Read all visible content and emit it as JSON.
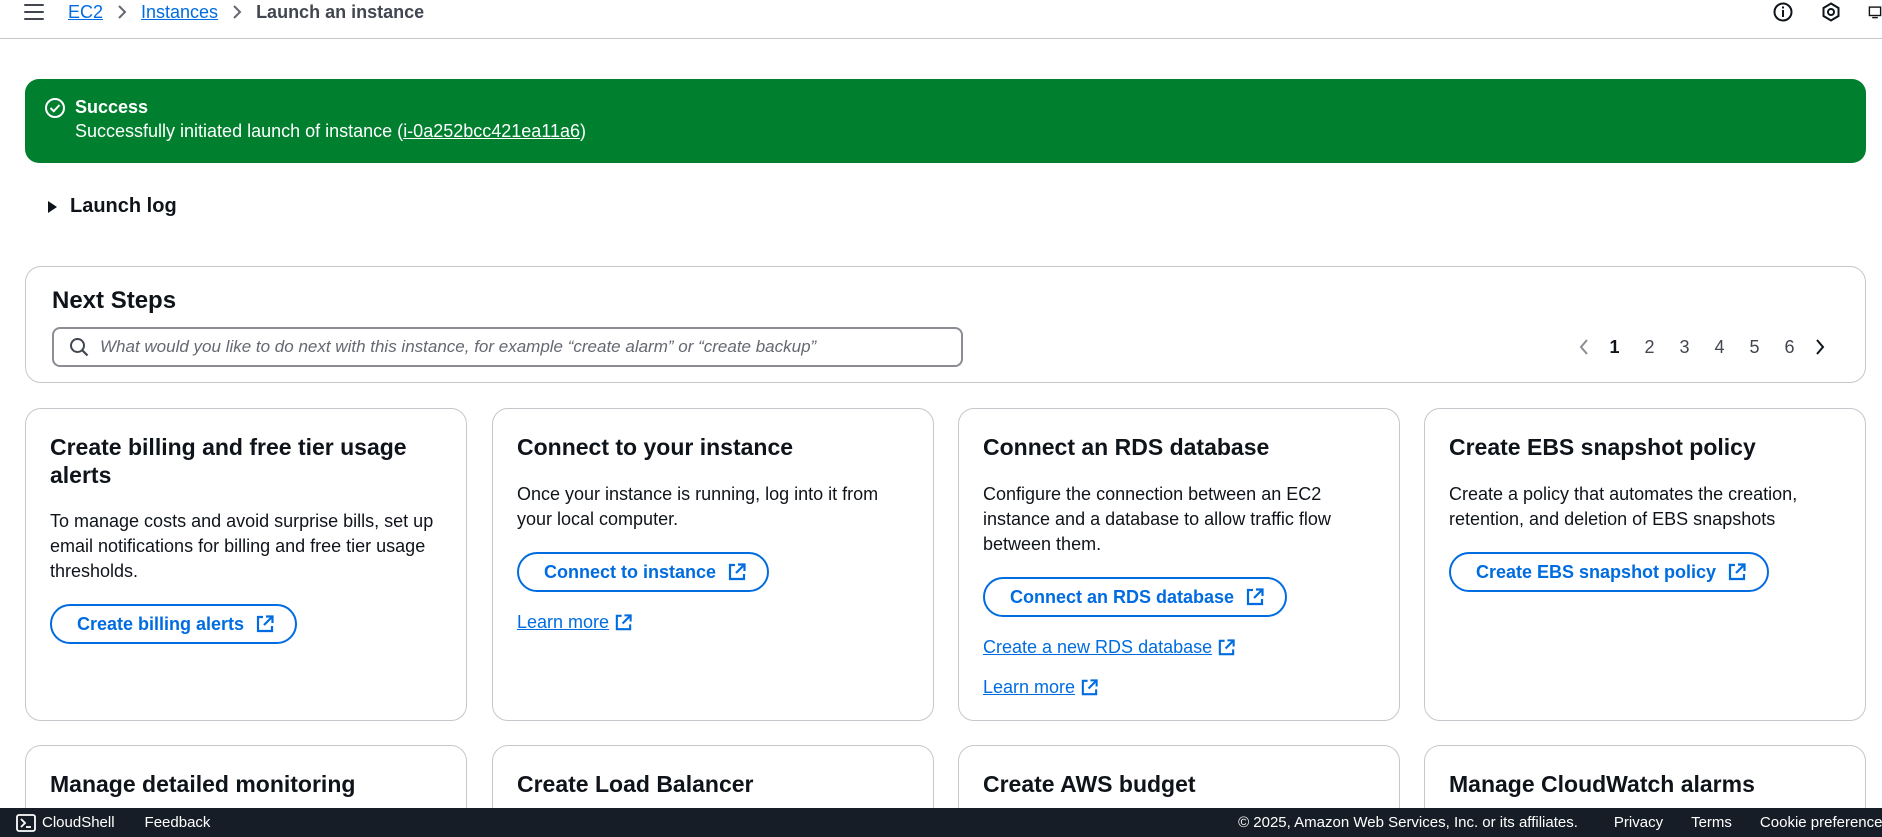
{
  "breadcrumb": {
    "items": [
      "EC2",
      "Instances"
    ],
    "current": "Launch an instance"
  },
  "flash": {
    "title": "Success",
    "message_prefix": "Successfully initiated launch of instance (",
    "instance_id": "i-0a252bcc421ea11a6",
    "message_suffix": ")",
    "color": "#00802f"
  },
  "launch_log": {
    "label": "Launch log"
  },
  "next_steps": {
    "title": "Next Steps",
    "search_placeholder": "What would you like to do next with this instance, for example “create alarm” or “create backup”",
    "pages": [
      "1",
      "2",
      "3",
      "4",
      "5",
      "6"
    ],
    "current_page": "1"
  },
  "cards": [
    {
      "title": "Create billing and free tier usage alerts",
      "description": "To manage costs and avoid surprise bills, set up email notifications for billing and free tier usage thresholds.",
      "button": "Create billing alerts"
    },
    {
      "title": "Connect to your instance",
      "description": "Once your instance is running, log into it from your local computer.",
      "button": "Connect to instance",
      "link": "Learn more"
    },
    {
      "title": "Connect an RDS database",
      "description": "Configure the connection between an EC2 instance and a database to allow traffic flow between them.",
      "button": "Connect an RDS database",
      "link": "Create a new RDS database",
      "link2": "Learn more"
    },
    {
      "title": "Create EBS snapshot policy",
      "description": "Create a policy that automates the creation, retention, and deletion of EBS snapshots",
      "button": "Create EBS snapshot policy"
    }
  ],
  "bottom_cards": [
    {
      "title": "Manage detailed monitoring"
    },
    {
      "title": "Create Load Balancer"
    },
    {
      "title": "Create AWS budget"
    },
    {
      "title": "Manage CloudWatch alarms"
    }
  ],
  "footer": {
    "cloudshell": "CloudShell",
    "feedback": "Feedback",
    "copyright": "© 2025, Amazon Web Services, Inc. or its affiliates.",
    "privacy": "Privacy",
    "terms": "Terms",
    "cookie": "Cookie preferences"
  },
  "colors": {
    "accent": "#006ce0",
    "success": "#00802f",
    "footer_bg": "#161d26",
    "text": "#0f141a"
  }
}
